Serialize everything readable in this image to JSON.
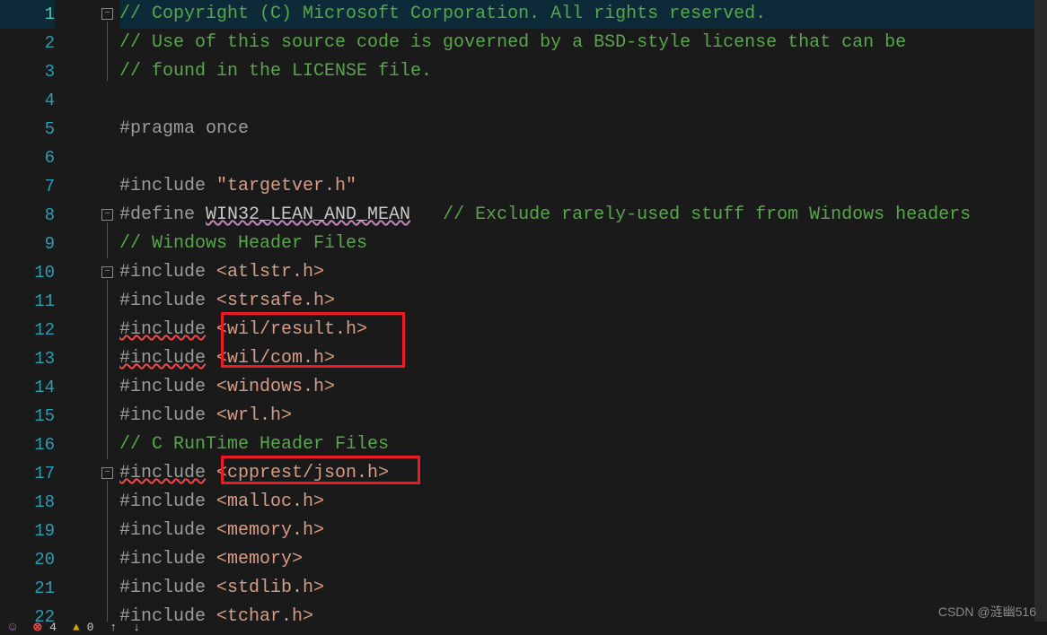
{
  "lines": {
    "l1": {
      "num": "1",
      "comment": "// Copyright (C) Microsoft Corporation. All rights reserved."
    },
    "l2": {
      "num": "2",
      "comment": "// Use of this source code is governed by a BSD-style license that can be"
    },
    "l3": {
      "num": "3",
      "comment": "// found in the LICENSE file."
    },
    "l4": {
      "num": "4"
    },
    "l5": {
      "num": "5",
      "pp": "#pragma once"
    },
    "l6": {
      "num": "6"
    },
    "l7": {
      "num": "7",
      "pp": "#include ",
      "str": "\"targetver.h\""
    },
    "l8": {
      "num": "8",
      "pp": "#define ",
      "macro": "WIN32_LEAN_AND_MEAN",
      "comment": "   // Exclude rarely-used stuff from Windows headers"
    },
    "l9": {
      "num": "9",
      "comment": "// Windows Header Files"
    },
    "l10": {
      "num": "10",
      "pp": "#include ",
      "angled": "<atlstr.h>"
    },
    "l11": {
      "num": "11",
      "pp": "#include ",
      "angled": "<strsafe.h>"
    },
    "l12": {
      "num": "12",
      "pp": "#include",
      "sp": " ",
      "angled": "<wil/result.h>"
    },
    "l13": {
      "num": "13",
      "pp": "#include",
      "sp": " ",
      "angled": "<wil/com.h>"
    },
    "l14": {
      "num": "14",
      "pp": "#include ",
      "angled": "<windows.h>"
    },
    "l15": {
      "num": "15",
      "pp": "#include ",
      "angled": "<wrl.h>"
    },
    "l16": {
      "num": "16",
      "comment": "// C RunTime Header Files"
    },
    "l17": {
      "num": "17",
      "pp": "#include",
      "sp": " ",
      "angled": "<cpprest/json.h>"
    },
    "l18": {
      "num": "18",
      "pp": "#include ",
      "angled": "<malloc.h>"
    },
    "l19": {
      "num": "19",
      "pp": "#include ",
      "angled": "<memory.h>"
    },
    "l20": {
      "num": "20",
      "pp": "#include ",
      "angled": "<memory>"
    },
    "l21": {
      "num": "21",
      "pp": "#include ",
      "angled": "<stdlib.h>"
    },
    "l22": {
      "num": "22",
      "pp": "#include ",
      "angled": "<tchar.h>"
    }
  },
  "statusbar": {
    "errors": "4",
    "warnings": "0"
  },
  "watermark": "CSDN @涟幽516"
}
